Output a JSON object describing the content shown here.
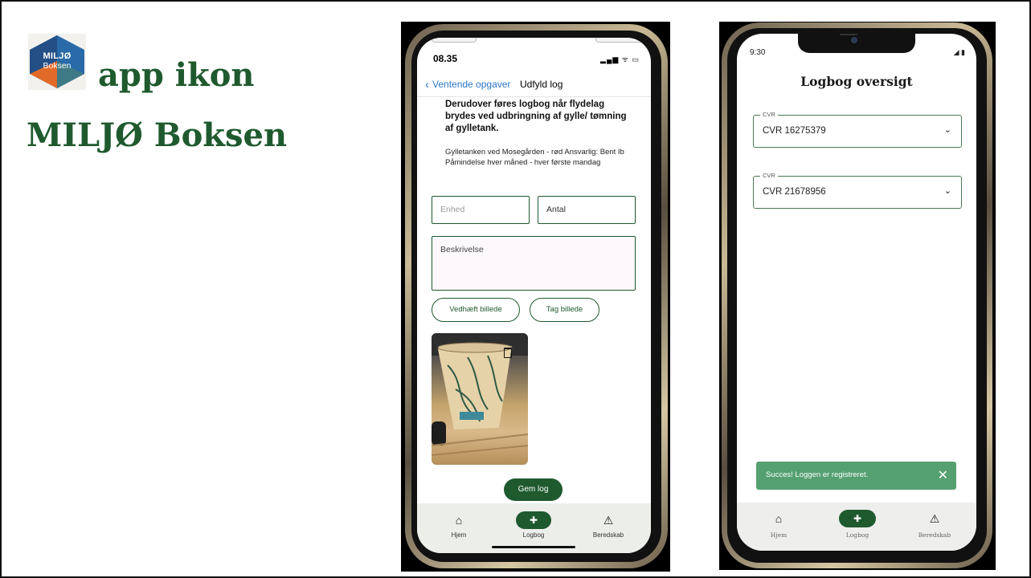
{
  "slide": {
    "logo": {
      "line1": "MILJØ",
      "line2": "Boksen"
    },
    "headline_line1": "app ikon",
    "headline_line2": "MILJØ Boksen"
  },
  "phone_left": {
    "status": {
      "time": "08.35",
      "icons": "▂▄▆ ᯤ ▭"
    },
    "nav": {
      "back_label": "Ventende opgaver",
      "title": "Udfyld log"
    },
    "task_title": "Derudover føres logbog når flydelag brydes ved udbringning af gylle/ tømning af gylletank.",
    "task_description": "Gylletanken ved Mosegården - rød Ansvarlig: Bent Ib Påmindelse hver måned - hver første mandag",
    "form": {
      "unit_placeholder": "Enhed",
      "count_value": "Antal",
      "description_value": "Beskrivelse",
      "attach_button": "Vedhæft billede",
      "take_photo_button": "Tag billede",
      "save_button": "Gem log"
    },
    "tabbar": {
      "items": [
        {
          "label": "Hjem",
          "icon": "home-icon",
          "glyph": "⌂"
        },
        {
          "label": "Logbog",
          "icon": "logbook-add-icon",
          "glyph": "✚"
        },
        {
          "label": "Beredskab",
          "icon": "warning-icon",
          "glyph": "⚠"
        }
      ]
    }
  },
  "phone_right": {
    "status": {
      "time": "9:30",
      "icons": "◢ ▮"
    },
    "title": "Logbog oversigt",
    "selects": [
      {
        "label": "CVR",
        "value": "CVR 16275379"
      },
      {
        "label": "CVR",
        "value": "CVR 21678956"
      }
    ],
    "toast": {
      "message": "Succes! Loggen er registreret.",
      "close": "✕"
    },
    "tabbar": {
      "items": [
        {
          "label": "Hjem",
          "icon": "home-icon",
          "glyph": "⌂"
        },
        {
          "label": "Logbog",
          "icon": "logbook-add-icon",
          "glyph": "✚"
        },
        {
          "label": "Beredskab",
          "icon": "warning-icon",
          "glyph": "⚠"
        }
      ]
    }
  },
  "colors": {
    "brand_green": "#1f5a2e",
    "toast_green": "#55a071",
    "link_blue": "#2c78c9",
    "logo_blue": "#2a6aa8",
    "logo_orange": "#e26a28",
    "logo_teal": "#3d7a86"
  }
}
